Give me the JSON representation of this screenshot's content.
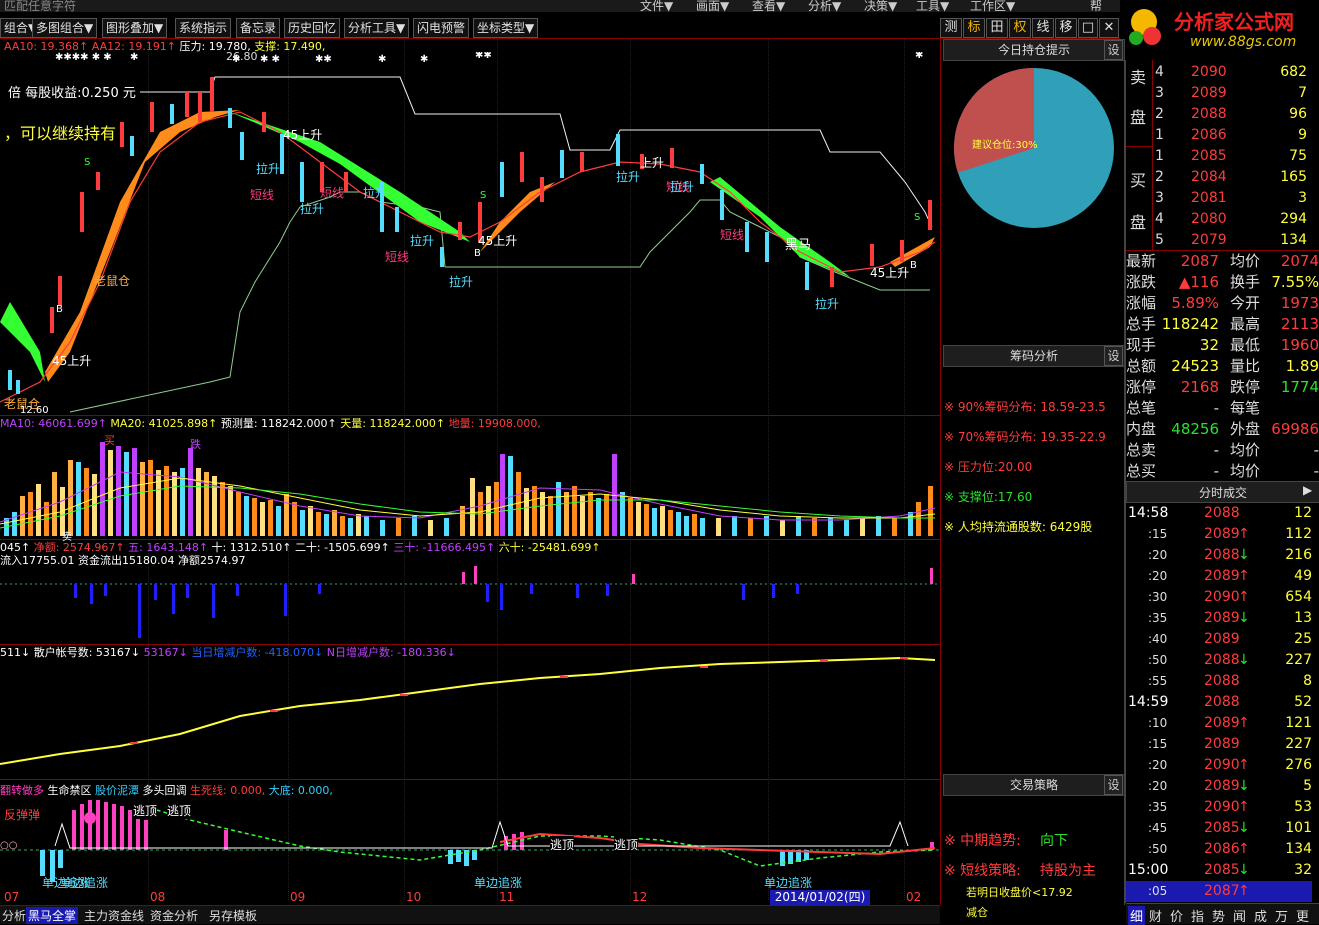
{
  "top_menu": [
    "文件▼",
    "画面▼",
    "查看▼",
    "分析▼",
    "决策▼",
    "工具▼",
    "工作区▼",
    "帮"
  ],
  "search_hint": "匹配任意字符",
  "toolbar": {
    "buttons": [
      "组合▼",
      "多图组合▼",
      "图形叠加▼",
      "系统指示",
      "备忘录",
      "历史回忆",
      "分析工具▼",
      "闪电预警",
      "坐标类型▼"
    ],
    "right_buttons": [
      "测",
      "标",
      "田",
      "权",
      "线",
      "移",
      "□",
      "✕"
    ]
  },
  "logo": {
    "name": "分析家公式网",
    "url": "www.88gs.com"
  },
  "main_chart": {
    "ma_line": [
      "AA10: 19.368↑",
      "AA12: 19.191↑",
      "压力: 19.780,",
      "支撑: 17.490,"
    ],
    "top_price": "26.80",
    "bottom_price": "12.60",
    "texts": [
      "倍  每股收益:0.250 元",
      "，可以继续持有"
    ],
    "annotations": [
      "老鼠仓",
      "老鼠仓",
      "45上升",
      "B",
      "S",
      "45上升",
      "拉升",
      "短线",
      "拉升",
      "短线",
      "拉升",
      "拉升",
      "短线",
      "拉升",
      "45上升",
      "B",
      "S",
      "拉升",
      "上升",
      "短线",
      "拉升",
      "黑马",
      "短线",
      "拉升",
      "45上升",
      "B",
      "S"
    ]
  },
  "volume": {
    "line": [
      "MA10: 46061.699↑",
      "MA20: 41025.898↑",
      "预测量: 118242.000↑",
      "天量: 118242.000↑",
      "地量: 19908.000,"
    ],
    "labels": [
      "买",
      "跌",
      "卖"
    ]
  },
  "capital": {
    "line1": [
      "045↑",
      "净额: 2574.967↑",
      "五: 1643.148↑",
      "十: 1312.510↑",
      "二十: -1505.699↑",
      "三十: -11666.495↑",
      "六十: -25481.699↑"
    ],
    "line2": "流入17755.01  资金流出15180.04  净额2574.97"
  },
  "accounts": {
    "line": [
      "511↓",
      "散户帐号数: 53167↓",
      "53167↓",
      "当日增减户数: -418.070↓",
      "N日增减户数: -180.336↓"
    ]
  },
  "bottom_ind": {
    "line": [
      "翻转做多",
      "生命禁区",
      "股价泥潭",
      "多头回调",
      "生死线: 0.000,",
      "大底: 0.000,"
    ],
    "annotations": [
      "反弹弹",
      "逃顶",
      "逃顶",
      "单边追涨",
      "单边追涨",
      "逃顶",
      "逃顶",
      "单边追涨",
      "单边追涨"
    ]
  },
  "x_axis": [
    "07",
    "08",
    "09",
    "10",
    "11",
    "12",
    "01",
    "02"
  ],
  "date_box": "2014/01/02(四)",
  "bottom_tabs": [
    "分析",
    "黑马全掌",
    "主力资金线",
    "资金分析",
    "另存模板"
  ],
  "right_panel": {
    "hold_title": "今日持仓提示",
    "hold_settings": "设",
    "pie_label": "建议仓位:30%",
    "pie_percent": 30,
    "chip_title": "筹码分析",
    "chip_items": [
      "※ 90%筹码分布: 18.59-23.5",
      "※ 70%筹码分布: 19.35-22.9",
      "※ 压力位:20.00",
      "※ 支撑位:17.60",
      "※ 人均持流通股数:  6429股"
    ],
    "strategy_title": "交易策略",
    "strategy_items": [
      {
        "k": "※ 中期趋势:",
        "v": "向下"
      },
      {
        "k": "※ 短线策略:",
        "v": "持股为主"
      }
    ],
    "strategy_note": "若明日收盘价<17.92",
    "strategy_note2": "减仓"
  },
  "order_book": {
    "sell_label": [
      "卖",
      "盘"
    ],
    "buy_label": [
      "买",
      "盘"
    ],
    "sells": [
      {
        "lvl": "4",
        "price": "2090",
        "vol": "682"
      },
      {
        "lvl": "3",
        "price": "2089",
        "vol": "7"
      },
      {
        "lvl": "2",
        "price": "2088",
        "vol": "96"
      },
      {
        "lvl": "1",
        "price": "2086",
        "vol": "9"
      }
    ],
    "buys": [
      {
        "lvl": "1",
        "price": "2085",
        "vol": "75"
      },
      {
        "lvl": "2",
        "price": "2084",
        "vol": "165"
      },
      {
        "lvl": "3",
        "price": "2081",
        "vol": "3"
      },
      {
        "lvl": "4",
        "price": "2080",
        "vol": "294"
      },
      {
        "lvl": "5",
        "price": "2079",
        "vol": "134"
      }
    ]
  },
  "quote": [
    {
      "k1": "最新",
      "v1": "2087",
      "k2": "均价",
      "v2": "2074"
    },
    {
      "k1": "涨跌",
      "v1": "▲116",
      "k2": "换手",
      "v2": "7.55%"
    },
    {
      "k1": "涨幅",
      "v1": "5.89%",
      "k2": "今开",
      "v2": "1973"
    },
    {
      "k1": "总手",
      "v1": "118242",
      "k2": "最高",
      "v2": "2113"
    },
    {
      "k1": "现手",
      "v1": "32",
      "k2": "最低",
      "v2": "1960"
    },
    {
      "k1": "总额",
      "v1": "24523",
      "k2": "量比",
      "v2": "1.89"
    },
    {
      "k1": "涨停",
      "v1": "2168",
      "k2": "跌停",
      "v2": "1774"
    },
    {
      "k1": "总笔",
      "v1": "-",
      "k2": "每笔",
      "v2": ""
    },
    {
      "k1": "内盘",
      "v1": "48256",
      "k2": "外盘",
      "v2": "69986"
    },
    {
      "k1": "总卖",
      "v1": "-",
      "k2": "均价",
      "v2": "-"
    },
    {
      "k1": "总买",
      "v1": "-",
      "k2": "均价",
      "v2": "-"
    }
  ],
  "ticks_title": "分时成交",
  "ticks": [
    {
      "t": "14:58",
      "p": "2088",
      "a": "",
      "v": "12"
    },
    {
      "t": ":15",
      "p": "2089",
      "a": "↑",
      "v": "112"
    },
    {
      "t": ":20",
      "p": "2088",
      "a": "↓",
      "v": "216"
    },
    {
      "t": ":20",
      "p": "2089",
      "a": "↑",
      "v": "49"
    },
    {
      "t": ":30",
      "p": "2090",
      "a": "↑",
      "v": "654"
    },
    {
      "t": ":35",
      "p": "2089",
      "a": "↓",
      "v": "13"
    },
    {
      "t": ":40",
      "p": "2089",
      "a": "",
      "v": "25"
    },
    {
      "t": ":50",
      "p": "2088",
      "a": "↓",
      "v": "227"
    },
    {
      "t": ":55",
      "p": "2088",
      "a": "",
      "v": "8"
    },
    {
      "t": "14:59",
      "p": "2088",
      "a": "",
      "v": "52"
    },
    {
      "t": ":10",
      "p": "2089",
      "a": "↑",
      "v": "121"
    },
    {
      "t": ":15",
      "p": "2089",
      "a": "",
      "v": "227"
    },
    {
      "t": ":20",
      "p": "2090",
      "a": "↑",
      "v": "276"
    },
    {
      "t": ":20",
      "p": "2089",
      "a": "↓",
      "v": "5"
    },
    {
      "t": ":35",
      "p": "2090",
      "a": "↑",
      "v": "53"
    },
    {
      "t": ":45",
      "p": "2085",
      "a": "↓",
      "v": "101"
    },
    {
      "t": ":50",
      "p": "2086",
      "a": "↑",
      "v": "134"
    },
    {
      "t": "15:00",
      "p": "2085",
      "a": "↓",
      "v": "32"
    },
    {
      "t": ":05",
      "p": "2087",
      "a": "↑",
      "v": ""
    }
  ],
  "right_tabs": [
    "细",
    "财",
    "价",
    "指",
    "势",
    "闻",
    "成",
    "万",
    "更"
  ]
}
